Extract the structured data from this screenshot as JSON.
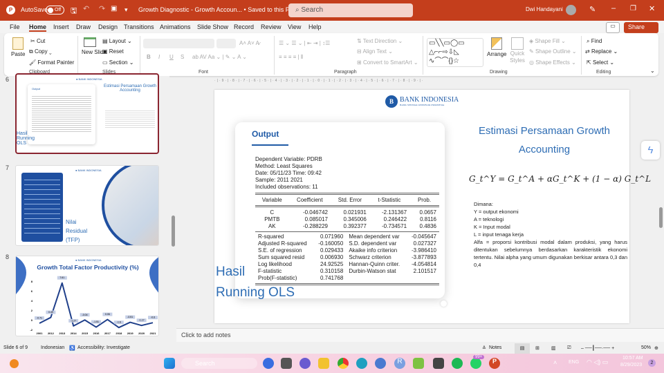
{
  "titlebar": {
    "autosave": "AutoSave",
    "autosave_state": "Off",
    "doc_title": "Growth Diagnostic - Growth Accoun... • Saved to this PC ⌄",
    "search": "Search",
    "user": "Dwi Handayani"
  },
  "tabs": [
    "File",
    "Home",
    "Insert",
    "Draw",
    "Design",
    "Transitions",
    "Animations",
    "Slide Show",
    "Record",
    "Review",
    "View",
    "Help"
  ],
  "share": "Share",
  "ribbon": {
    "clipboard": {
      "paste": "Paste",
      "cut": "Cut",
      "copy": "Copy",
      "format_painter": "Format Painter",
      "label": "Clipboard"
    },
    "slides": {
      "new_slide": "New Slide",
      "layout": "Layout",
      "reset": "Reset",
      "section": "Section",
      "label": "Slides"
    },
    "font": {
      "label": "Font",
      "bold": "B",
      "italic": "I",
      "underline": "U",
      "strike": "S"
    },
    "paragraph": {
      "text_direction": "Text Direction",
      "align_text": "Align Text",
      "convert": "Convert to SmartArt",
      "label": "Paragraph"
    },
    "drawing": {
      "arrange": "Arrange",
      "quick_styles": "Quick Styles",
      "shape_fill": "Shape Fill",
      "shape_outline": "Shape Outline",
      "shape_effects": "Shape Effects",
      "label": "Drawing"
    },
    "editing": {
      "find": "Find",
      "replace": "Replace",
      "select": "Select",
      "label": "Editing"
    }
  },
  "thumbs": {
    "s6": {
      "num": "6",
      "title": "Estimasi Persamaan Growth Accounting",
      "left": "Hasil Running OLS",
      "card": "Output"
    },
    "s7": {
      "num": "7",
      "title": "Nilai Residual (TFP)"
    },
    "s8": {
      "num": "8",
      "title": "Growth Total Factor Productivity (%)"
    }
  },
  "chart_data": {
    "type": "line",
    "title": "Growth Total Factor Productivity (%)",
    "categories": [
      "2001",
      "2012",
      "2013",
      "2014",
      "2015",
      "2016",
      "2017",
      "2018",
      "2019",
      "2020",
      "2021"
    ],
    "values": [
      -0.71,
      0.49,
      7.61,
      -1.27,
      -0.04,
      -1.51,
      0.06,
      -1.6,
      -0.51,
      -1.17,
      -0.6
    ],
    "ylim": [
      -2,
      8
    ],
    "yticks": [
      "8",
      "6",
      "4",
      "2",
      "0",
      "-2"
    ]
  },
  "slide": {
    "logo": "BANK INDONESIA",
    "logo_sub": "BANK SENTRAL REPUBLIK INDONESIA",
    "card_title": "Output",
    "header_lines": [
      "Dependent Variable: PDRB",
      "Method: Least Squares",
      "Date: 05/11/23   Time: 09:42",
      "Sample: 2011 2021",
      "Included observations: 11"
    ],
    "table_cols": [
      "Variable",
      "Coefficient",
      "Std. Error",
      "t-Statistic",
      "Prob."
    ],
    "table_rows": [
      [
        "C",
        "-0.046742",
        "0.021931",
        "-2.131367",
        "0.0657"
      ],
      [
        "PMTB",
        "0.085017",
        "0.345006",
        "0.246422",
        "0.8116"
      ],
      [
        "AK",
        "-0.288229",
        "0.392377",
        "-0.734571",
        "0.4836"
      ]
    ],
    "stats": [
      [
        "R-squared",
        "0.071960",
        "Mean dependent var",
        "-0.045647"
      ],
      [
        "Adjusted R-squared",
        "-0.160050",
        "S.D. dependent var",
        "0.027327"
      ],
      [
        "S.E. of regression",
        "0.029433",
        "Akaike info criterion",
        "-3.986410"
      ],
      [
        "Sum squared resid",
        "0.006930",
        "Schwarz criterion",
        "-3.877893"
      ],
      [
        "Log likelihood",
        "24.92525",
        "Hannan-Quinn criter.",
        "-4.054814"
      ],
      [
        "F-statistic",
        "0.310158",
        "Durbin-Watson stat",
        "2.101517"
      ],
      [
        "Prob(F-statistic)",
        "0.741768",
        "",
        ""
      ]
    ],
    "left_title_1": "Hasil",
    "left_title_2": "Running OLS",
    "right_title": "Estimasi Persamaan Growth Accounting",
    "equation": "G_t^Y = G_t^A + αG_t^K + (1 − α) G_t^L",
    "desc": [
      "Dimana:",
      "Y = output ekonomi",
      "A = teknologi",
      "K = Input modal",
      "L = input tenaga kerja",
      "Alfa = proporsi kontribusi modal dalam produksi, yang harus ditentukan sebelumnya berdasarkan karakteristik ekonomi  tertentu. Nilai alpha yang umum digunakan berkisar antara 0,3 dan 0,4"
    ]
  },
  "notes_placeholder": "Click to add notes",
  "status": {
    "slide": "Slide 6 of 9",
    "language": "Indonesian",
    "accessibility": "Accessibility: Investigate",
    "notes": "Notes",
    "zoom": "50%"
  },
  "taskbar": {
    "search": "Search",
    "lang": "ENG",
    "time": "10:57 AM",
    "date": "8/29/2023",
    "badge": "99+",
    "notif": "2"
  },
  "colors": {
    "accent": "#c43e1c",
    "bi_blue": "#1f5aa6",
    "slide_title": "#2e6db4"
  }
}
